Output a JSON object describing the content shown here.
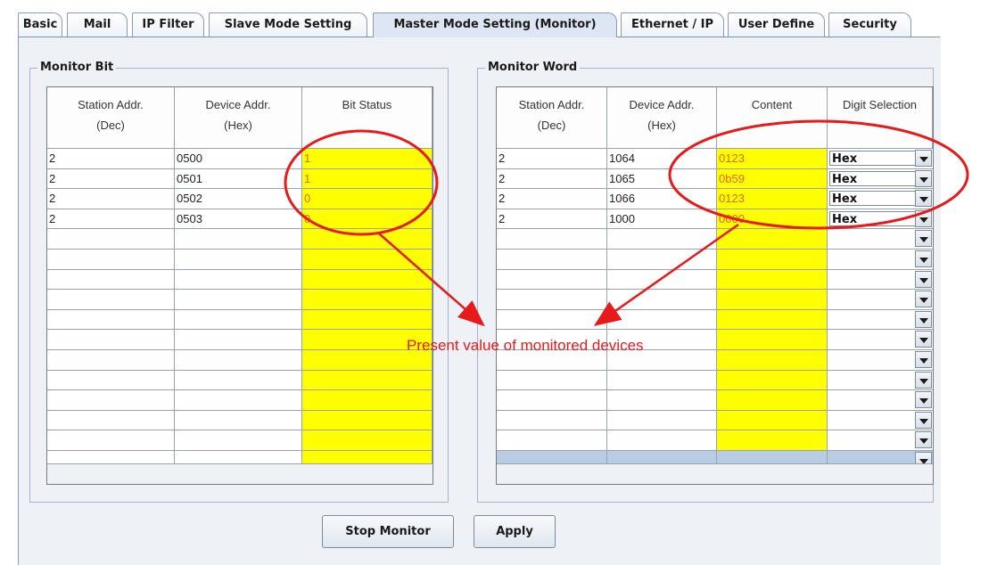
{
  "tabs": [
    {
      "label": "Basic",
      "active": false
    },
    {
      "label": "Mail",
      "active": false
    },
    {
      "label": "IP Filter",
      "active": false
    },
    {
      "label": "Slave Mode Setting",
      "active": false
    },
    {
      "label": "Master Mode Setting (Monitor)",
      "active": true
    },
    {
      "label": "Ethernet / IP",
      "active": false
    },
    {
      "label": "User Define",
      "active": false
    },
    {
      "label": "Security",
      "active": false
    }
  ],
  "monitor_bit": {
    "title": "Monitor Bit",
    "headers": [
      "Station Addr.\n(Dec)",
      "Device Addr.\n(Hex)",
      "Bit Status"
    ],
    "rows": [
      [
        "2",
        "0500",
        "1"
      ],
      [
        "2",
        "0501",
        "1"
      ],
      [
        "2",
        "0502",
        "0"
      ],
      [
        "2",
        "0503",
        "0"
      ],
      [
        "",
        "",
        ""
      ],
      [
        "",
        "",
        ""
      ],
      [
        "",
        "",
        ""
      ],
      [
        "",
        "",
        ""
      ],
      [
        "",
        "",
        ""
      ],
      [
        "",
        "",
        ""
      ],
      [
        "",
        "",
        ""
      ],
      [
        "",
        "",
        ""
      ],
      [
        "",
        "",
        ""
      ],
      [
        "",
        "",
        ""
      ],
      [
        "",
        "",
        ""
      ],
      [
        "",
        "",
        ""
      ]
    ]
  },
  "monitor_word": {
    "title": "Monitor Word",
    "headers": [
      "Station Addr.\n(Dec)",
      "Device Addr.\n(Hex)",
      "Content",
      "Digit Selection"
    ],
    "rows": [
      [
        "2",
        "1064",
        "0123",
        "Hex"
      ],
      [
        "2",
        "1065",
        "0b59",
        "Hex"
      ],
      [
        "2",
        "1066",
        "0123",
        "Hex"
      ],
      [
        "2",
        "1000",
        "0000",
        "Hex"
      ],
      [
        "",
        "",
        "",
        ""
      ],
      [
        "",
        "",
        "",
        ""
      ],
      [
        "",
        "",
        "",
        ""
      ],
      [
        "",
        "",
        "",
        ""
      ],
      [
        "",
        "",
        "",
        ""
      ],
      [
        "",
        "",
        "",
        ""
      ],
      [
        "",
        "",
        "",
        ""
      ],
      [
        "",
        "",
        "",
        ""
      ],
      [
        "",
        "",
        "",
        ""
      ],
      [
        "",
        "",
        "",
        ""
      ],
      [
        "",
        "",
        "",
        ""
      ],
      [
        "",
        "",
        "",
        ""
      ]
    ],
    "selected_row": 15
  },
  "buttons": {
    "stop_monitor": "Stop Monitor",
    "apply": "Apply"
  },
  "annotation": {
    "text": "Present value of monitored devices",
    "color": "#e8191a"
  },
  "colors": {
    "highlight": "#ffff00",
    "value_text": "#e0681a",
    "selection": "#b8cde3"
  },
  "icons": {
    "combo_dropdown": "chevron-down-icon"
  }
}
